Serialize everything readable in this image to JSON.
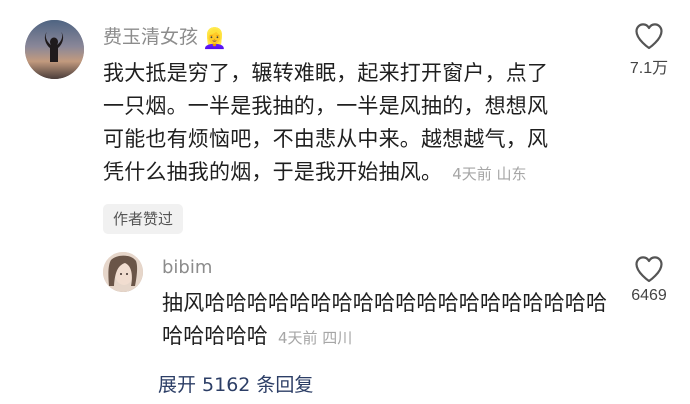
{
  "main_comment": {
    "username": "费玉清女孩",
    "username_emoji": "👱‍♀️",
    "text_lines": [
      "我大抵是穷了，辗转难眠，起来打开窗户，点了",
      "一只烟。一半是我抽的，一半是风抽的，想想风",
      "可能也有烦恼吧，不由悲从中来。越想越气，风",
      "凭什么抽我的烟，于是我开始抽风。"
    ],
    "meta": "4天前 山东",
    "author_liked_badge": "作者赞过",
    "like_count": "7.1万",
    "like_icon": "heart-outline-icon"
  },
  "reply": {
    "username": "bibim",
    "text_lines": [
      "抽风哈哈哈哈哈哈哈哈哈哈哈哈哈哈哈哈哈哈哈",
      "哈哈哈哈哈"
    ],
    "meta": "4天前 四川",
    "like_count": "6469",
    "like_icon": "heart-outline-icon"
  },
  "expand_replies_label": "展开 5162 条回复",
  "colors": {
    "username": "#8c8c8c",
    "meta": "#a6a6a6",
    "expand_link": "#2c3e66",
    "badge_bg": "#f1f1f1"
  }
}
